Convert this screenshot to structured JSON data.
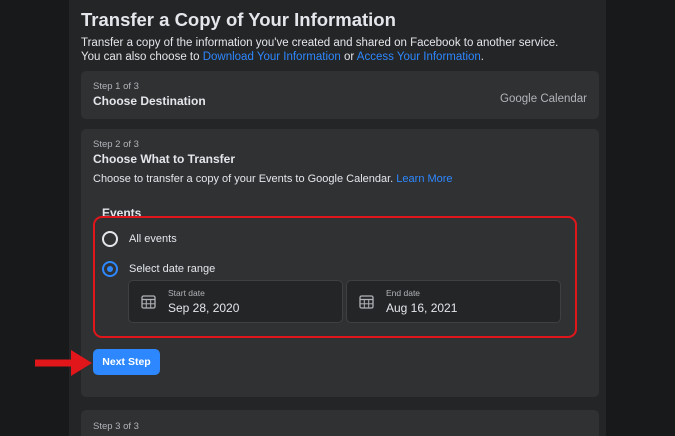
{
  "page": {
    "title": "Transfer a Copy of Your Information",
    "intro_line1": "Transfer a copy of the information you've created and shared on Facebook to another service.",
    "intro_prefix": "You can also choose to ",
    "intro_link1": "Download Your Information",
    "intro_mid": " or ",
    "intro_link2": "Access Your Information",
    "intro_suffix": "."
  },
  "step1": {
    "label": "Step 1 of 3",
    "title": "Choose Destination",
    "value": "Google Calendar"
  },
  "step2": {
    "label": "Step 2 of 3",
    "title": "Choose What to Transfer",
    "desc": "Choose to transfer a copy of your Events to Google Calendar. ",
    "learn_more": "Learn More",
    "events_heading": "Events",
    "options": [
      {
        "label": "All events",
        "selected": false
      },
      {
        "label": "Select date range",
        "selected": true
      }
    ],
    "start_date": {
      "caption": "Start date",
      "value": "Sep 28, 2020"
    },
    "end_date": {
      "caption": "End date",
      "value": "Aug 16, 2021"
    },
    "next_button": "Next Step"
  },
  "step3": {
    "label": "Step 3 of 3"
  },
  "colors": {
    "accent": "#2d88ff",
    "annotation": "#e0161b",
    "card": "#303133",
    "background": "#242526"
  },
  "icons": {
    "date_field": "calendar-icon",
    "annotation": "red-arrow"
  }
}
